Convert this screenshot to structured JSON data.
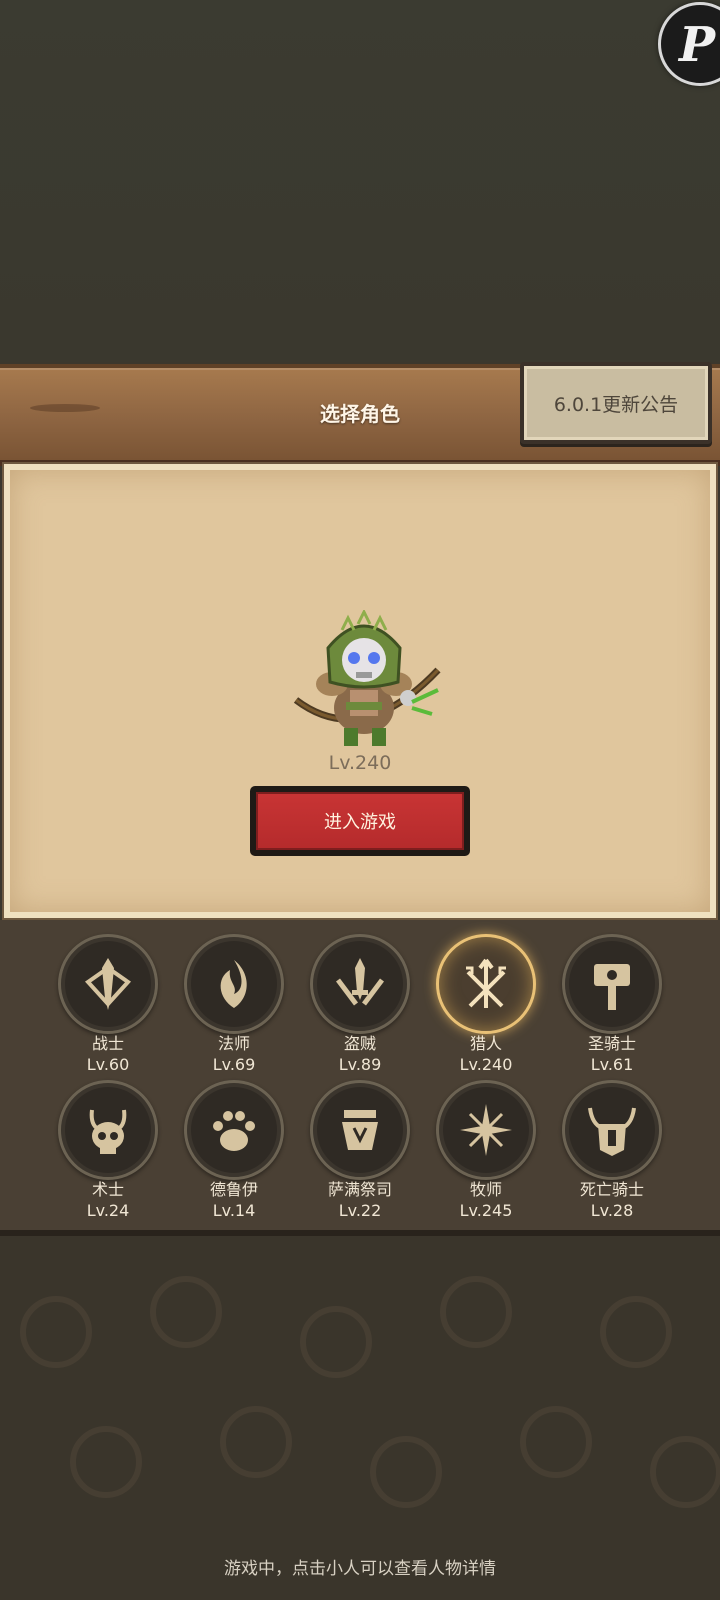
{
  "header": {
    "title": "选择角色",
    "notice_label": "6.0.1更新公告"
  },
  "character": {
    "level": "Lv.240"
  },
  "enter_label": "进入游戏",
  "classes": [
    {
      "name": "战士",
      "level": "Lv.60",
      "icon": "sword-shield-icon"
    },
    {
      "name": "法师",
      "level": "Lv.69",
      "icon": "flame-icon"
    },
    {
      "name": "盗贼",
      "level": "Lv.89",
      "icon": "daggers-icon"
    },
    {
      "name": "猎人",
      "level": "Lv.240",
      "icon": "arrows-icon",
      "selected": true
    },
    {
      "name": "圣骑士",
      "level": "Lv.61",
      "icon": "hammer-icon"
    },
    {
      "name": "术士",
      "level": "Lv.24",
      "icon": "skull-icon"
    },
    {
      "name": "德鲁伊",
      "level": "Lv.14",
      "icon": "paw-icon"
    },
    {
      "name": "萨满祭司",
      "level": "Lv.22",
      "icon": "totem-icon"
    },
    {
      "name": "牧师",
      "level": "Lv.245",
      "icon": "star-burst-icon"
    },
    {
      "name": "死亡骑士",
      "level": "Lv.28",
      "icon": "horned-helm-icon"
    }
  ],
  "tip": "游戏中，点击小人可以查看人物详情",
  "colors": {
    "accent_red": "#c83434",
    "selected_glow": "#e9c176",
    "panel_parchment": "#e0c69d"
  }
}
